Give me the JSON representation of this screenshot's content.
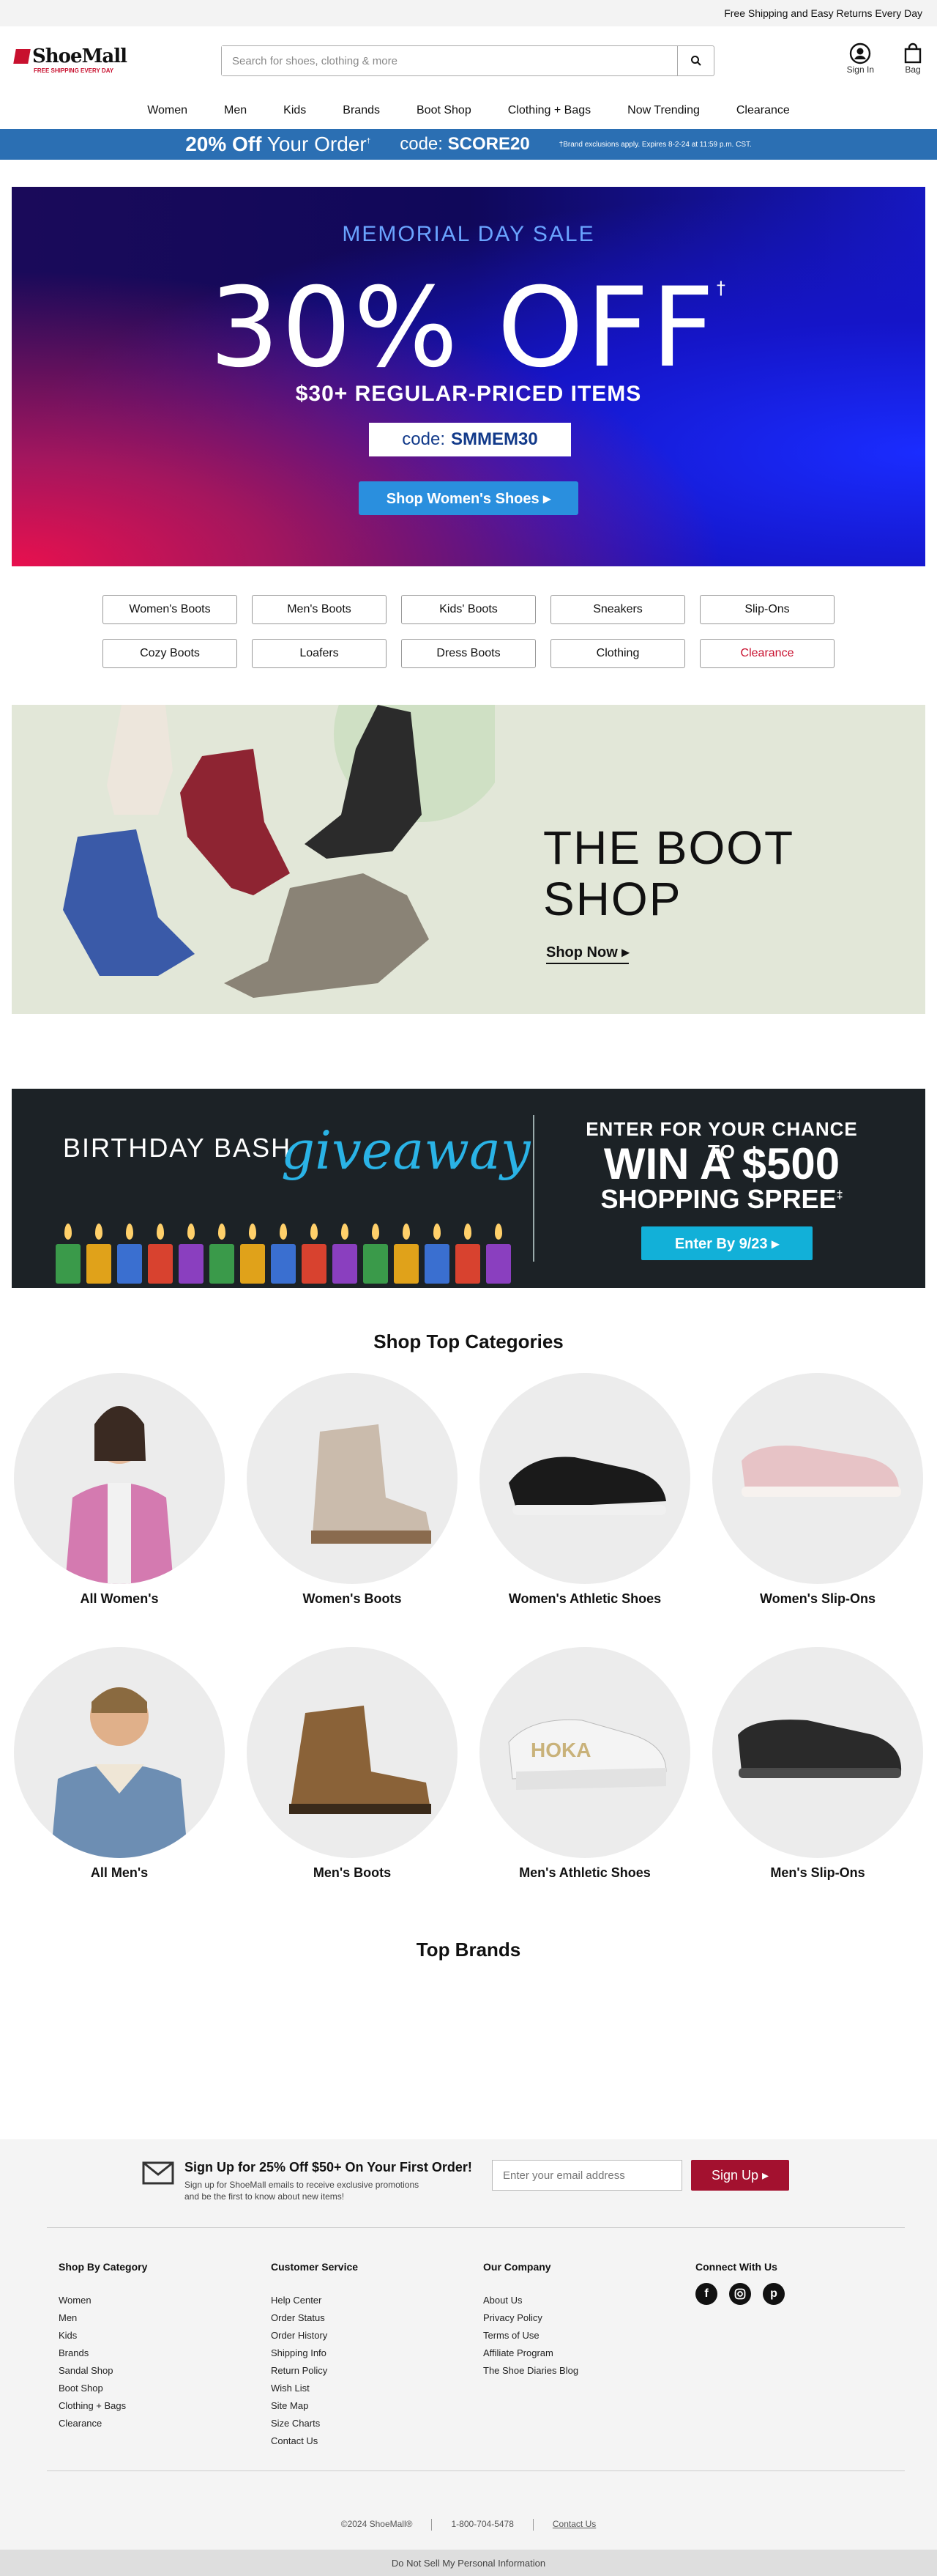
{
  "topbar": {
    "text": "Free Shipping and Easy Returns Every Day"
  },
  "logo": {
    "name": "ShoeMall",
    "tagline": "FREE SHIPPING EVERY DAY"
  },
  "search": {
    "placeholder": "Search for shoes, clothing & more",
    "icon": "search-icon"
  },
  "header_icons": [
    {
      "label": "Sign In",
      "icon": "user-icon"
    },
    {
      "label": "Bag",
      "icon": "bag-icon"
    }
  ],
  "nav": [
    "Women",
    "Men",
    "Kids",
    "Brands",
    "Boot Shop",
    "Clothing + Bags",
    "Now Trending",
    "Clearance"
  ],
  "promo_strip": {
    "offer_bold": "20% Off",
    "offer_rest": "Your Order",
    "code_label": "code:",
    "code": "SCORE20",
    "disclaimer": "†Brand exclusions apply. Expires 8-2-24 at 11:59 p.m. CST."
  },
  "hero": {
    "eyebrow": "MEMORIAL DAY SALE",
    "headline": "30% OFF",
    "subhead": "$30+ REGULAR-PRICED ITEMS",
    "code_label": "code:",
    "code": "SMMEM30",
    "cta": "Shop Women's Shoes ▸"
  },
  "category_buttons": [
    "Women's Boots",
    "Men's Boots",
    "Kids' Boots",
    "Sneakers",
    "Slip-Ons",
    "Cozy Boots",
    "Loafers",
    "Dress Boots",
    "Clothing",
    "Clearance"
  ],
  "boot_shop": {
    "title_line1": "THE BOOT",
    "title_line2": "SHOP",
    "cta": "Shop Now ▸"
  },
  "birthday": {
    "left": "BIRTHDAY BASH",
    "script": "giveaway",
    "line1": "ENTER FOR YOUR CHANCE TO",
    "line2": "WIN A $500",
    "line3": "SHOPPING SPREE",
    "cta": "Enter By 9/23 ▸"
  },
  "top_categories": {
    "title": "Shop Top Categories",
    "items": [
      "All Women's",
      "Women's Boots",
      "Women's Athletic Shoes",
      "Women's Slip-Ons",
      "All Men's",
      "Men's Boots",
      "Men's Athletic Shoes",
      "Men's Slip-Ons"
    ]
  },
  "top_brands": {
    "title": "Top Brands"
  },
  "signup": {
    "title": "Sign Up for 25% Off $50+ On Your First Order!",
    "subtitle": "Sign up for ShoeMall emails to receive exclusive promotions and be the first to know about new items!",
    "placeholder": "Enter your email address",
    "button": "Sign Up ▸"
  },
  "footer": {
    "shop_by_category": {
      "title": "Shop By Category",
      "links": [
        "Women",
        "Men",
        "Kids",
        "Brands",
        "Sandal Shop",
        "Boot Shop",
        "Clothing + Bags",
        "Clearance"
      ]
    },
    "customer_service": {
      "title": "Customer Service",
      "links": [
        "Help Center",
        "Order Status",
        "Order History",
        "Shipping Info",
        "Return Policy",
        "Wish List",
        "Site Map",
        "Size Charts",
        "Contact Us"
      ]
    },
    "our_company": {
      "title": "Our Company",
      "links": [
        "About Us",
        "Privacy Policy",
        "Terms of Use",
        "Affiliate Program",
        "The Shoe Diaries Blog"
      ]
    },
    "connect": {
      "title": "Connect With Us",
      "icons": [
        "facebook-icon",
        "instagram-icon",
        "pinterest-icon"
      ]
    },
    "copyright": "©2024 ShoeMall®",
    "phone": "1-800-704-5478",
    "contact": "Contact Us",
    "dnsm": "Do Not Sell My Personal Information"
  },
  "colors": {
    "accent_blue": "#2b6fb3",
    "signup_red": "#a3112f",
    "clearance_red": "#c8102e",
    "cyan": "#12b0d8"
  }
}
